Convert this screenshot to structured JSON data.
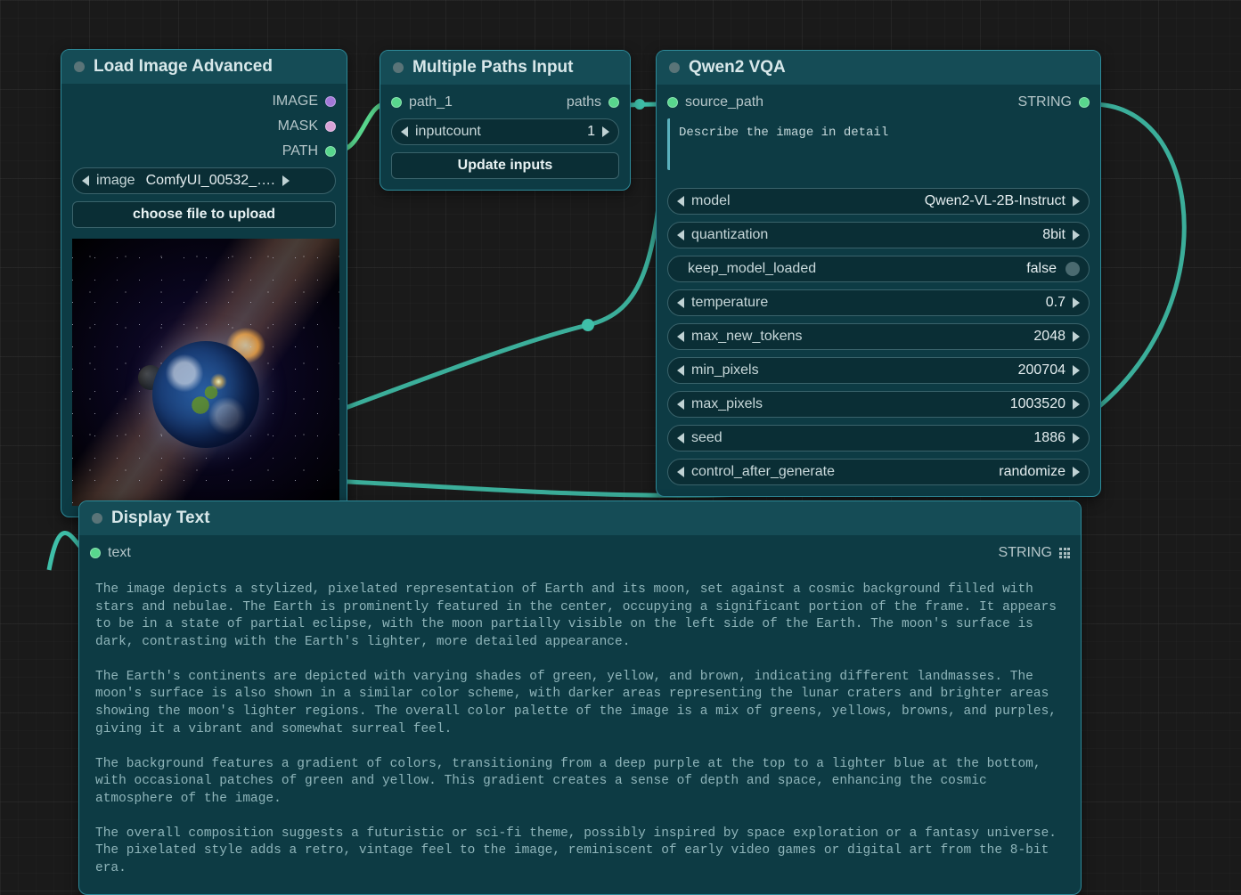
{
  "nodes": {
    "loadImage": {
      "title": "Load Image Advanced",
      "outputs": {
        "image": "IMAGE",
        "mask": "MASK",
        "path": "PATH"
      },
      "image_widget_label": "image",
      "image_widget_value": "ComfyUI_00532_….",
      "upload_btn": "choose file to upload"
    },
    "multiPaths": {
      "title": "Multiple Paths Input",
      "input_port": "path_1",
      "output_port": "paths",
      "inputcount_label": "inputcount",
      "inputcount_value": "1",
      "update_btn": "Update inputs"
    },
    "qwen": {
      "title": "Qwen2 VQA",
      "input_port": "source_path",
      "output_port": "STRING",
      "prompt": "Describe the image in detail",
      "params": {
        "model": {
          "label": "model",
          "value": "Qwen2-VL-2B-Instruct"
        },
        "quantization": {
          "label": "quantization",
          "value": "8bit"
        },
        "keep_model_loaded": {
          "label": "keep_model_loaded",
          "value": "false"
        },
        "temperature": {
          "label": "temperature",
          "value": "0.7"
        },
        "max_new_tokens": {
          "label": "max_new_tokens",
          "value": "2048"
        },
        "min_pixels": {
          "label": "min_pixels",
          "value": "200704"
        },
        "max_pixels": {
          "label": "max_pixels",
          "value": "1003520"
        },
        "seed": {
          "label": "seed",
          "value": "1886"
        },
        "control_after_generate": {
          "label": "control_after_generate",
          "value": "randomize"
        }
      }
    },
    "displayText": {
      "title": "Display Text",
      "input_port": "text",
      "output_port": "STRING",
      "text": "The image depicts a stylized, pixelated representation of Earth and its moon, set against a cosmic background filled with stars and nebulae. The Earth is prominently featured in the center, occupying a significant portion of the frame. It appears to be in a state of partial eclipse, with the moon partially visible on the left side of the Earth. The moon's surface is dark, contrasting with the Earth's lighter, more detailed appearance.\n\nThe Earth's continents are depicted with varying shades of green, yellow, and brown, indicating different landmasses. The moon's surface is also shown in a similar color scheme, with darker areas representing the lunar craters and brighter areas showing the moon's lighter regions. The overall color palette of the image is a mix of greens, yellows, browns, and purples, giving it a vibrant and somewhat surreal feel.\n\nThe background features a gradient of colors, transitioning from a deep purple at the top to a lighter blue at the bottom, with occasional patches of green and yellow. This gradient creates a sense of depth and space, enhancing the cosmic atmosphere of the image.\n\nThe overall composition suggests a futuristic or sci-fi theme, possibly inspired by space exploration or a fantasy universe. The pixelated style adds a retro, vintage feel to the image, reminiscent of early video games or digital art from the 8-bit era."
    }
  },
  "colors": {
    "cable_teal": "#3fbfa9",
    "cable_green": "#58d68d"
  }
}
